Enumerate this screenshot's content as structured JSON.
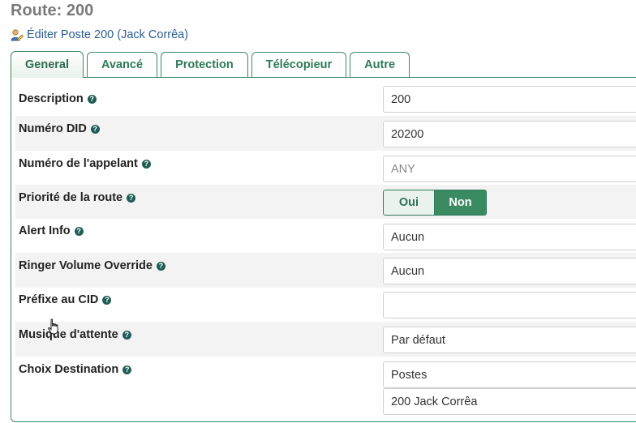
{
  "page": {
    "title": "Route: 200"
  },
  "edit_link": {
    "label": "Éditer Poste 200 (Jack Corrêa)",
    "icon": "user-edit-icon"
  },
  "tabs": [
    {
      "label": "General",
      "active": true
    },
    {
      "label": "Avancé",
      "active": false
    },
    {
      "label": "Protection",
      "active": false
    },
    {
      "label": "Télécopieur",
      "active": false
    },
    {
      "label": "Autre",
      "active": false
    }
  ],
  "form": {
    "description": {
      "label": "Description",
      "value": "200"
    },
    "did": {
      "label": "Numéro DID",
      "value": "20200"
    },
    "caller": {
      "label": "Numéro de l'appelant",
      "placeholder": "ANY"
    },
    "priority": {
      "label": "Priorité de la route",
      "yes": "Oui",
      "no": "Non",
      "selected": "Non"
    },
    "alert_info": {
      "label": "Alert Info",
      "value": "Aucun"
    },
    "ringer": {
      "label": "Ringer Volume Override",
      "value": "Aucun"
    },
    "cid_prefix": {
      "label": "Préfixe au CID",
      "value": ""
    },
    "moh": {
      "label": "Musique d'attente",
      "value": "Par défaut"
    },
    "destination": {
      "label": "Choix Destination",
      "type": "Postes",
      "target": "200 Jack Corrêa"
    }
  },
  "help_glyph": "?",
  "colors": {
    "accent": "#3a8a62",
    "tab_text": "#2d7a57",
    "link": "#2b5d8f",
    "title": "#7a7a7a"
  }
}
